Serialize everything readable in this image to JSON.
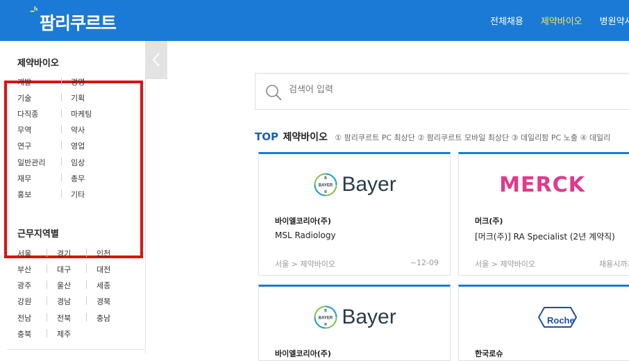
{
  "header": {
    "logo_text": "팜리쿠르트",
    "nav": [
      "전체채용",
      "제약바이오",
      "병원약사"
    ],
    "active_nav": "제약바이오"
  },
  "sidebar": {
    "category_title": "제약바이오",
    "categories": [
      [
        "개발",
        "경영"
      ],
      [
        "기술",
        "기획"
      ],
      [
        "다직종",
        "마케팅"
      ],
      [
        "무역",
        "약사"
      ],
      [
        "연구",
        "영업"
      ],
      [
        "일반관리",
        "임상"
      ],
      [
        "재무",
        "총무"
      ],
      [
        "홍보",
        "기타"
      ]
    ],
    "region_title": "근무지역별",
    "regions": [
      [
        "서울",
        "경기",
        "인천"
      ],
      [
        "부산",
        "대구",
        "대전"
      ],
      [
        "광주",
        "울산",
        "세종"
      ],
      [
        "강원",
        "경남",
        "경북"
      ],
      [
        "전남",
        "전북",
        "충남"
      ],
      [
        "충북",
        "제주"
      ]
    ]
  },
  "search": {
    "placeholder": "검색어 입력"
  },
  "top_section": {
    "label": "TOP",
    "category": "제약바이오",
    "note": "① 팜리쿠르트 PC 최상단 ② 팜리쿠르트 모바일 최상단 ③ 데일리팜 PC 노출 ④ 데일리"
  },
  "cards": [
    {
      "logo": "Bayer",
      "company": "바이엘코리아(주)",
      "title": "MSL Radiology",
      "meta": "서울 > 제약바이오",
      "date": "~12-09"
    },
    {
      "logo": "MERCK",
      "company": "머크(주)",
      "title": "[머크(주)] RA Specialist (2년 계약직)",
      "meta": "서울 > 제약바이오",
      "date": "채용시까지"
    },
    {
      "logo": "Bayer",
      "company": "바이엘코리아(주)",
      "title": "",
      "meta": "",
      "date": ""
    },
    {
      "logo": "Roche",
      "company": "한국로슈",
      "title": "",
      "meta": "",
      "date": ""
    }
  ],
  "colors": {
    "header_bg": "#1a7ad6",
    "active_nav": "#ffe65a",
    "highlight_box": "#e01010",
    "merck_pink": "#e3398a"
  }
}
